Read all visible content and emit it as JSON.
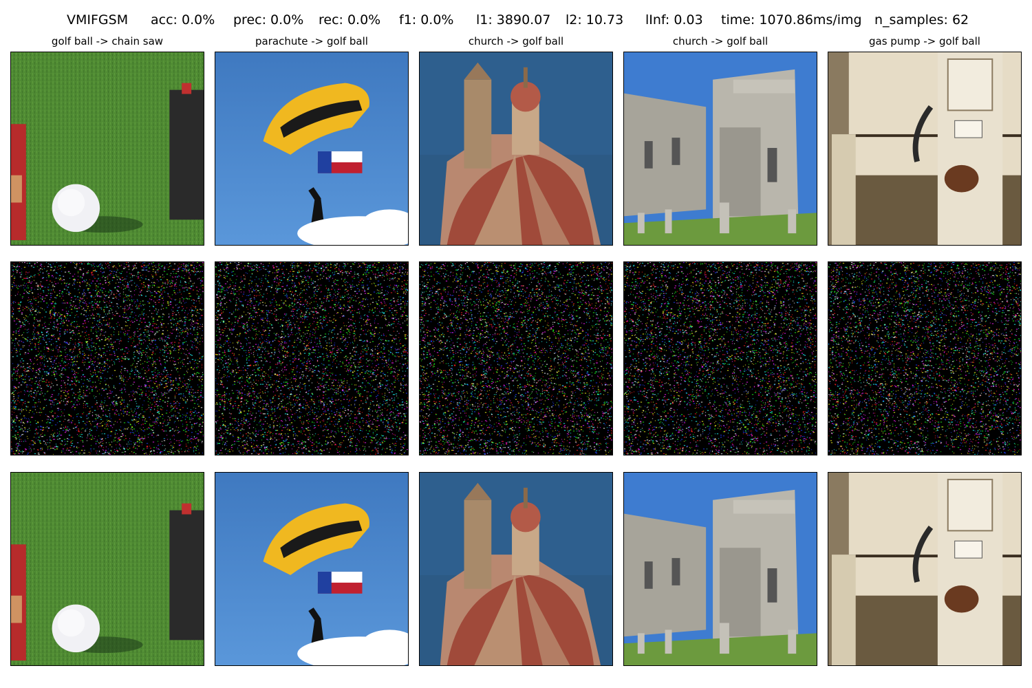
{
  "suptitle": {
    "method": "VMIFGSM",
    "acc": "acc: 0.0%",
    "prec": "prec: 0.0%",
    "rec": "rec: 0.0%",
    "f1": "f1: 0.0%",
    "l1": "l1: 3890.07",
    "l2": "l2: 10.73",
    "linf": "lInf: 0.03",
    "time": "time: 1070.86ms/img",
    "n_samples": "n_samples: 62"
  },
  "columns": [
    {
      "title": "golf ball -> chain saw",
      "image": "golf ball on grass with red sign and car battery"
    },
    {
      "title": "parachute -> golf ball",
      "image": "parachutist with yellow Army canopy and Texas flag"
    },
    {
      "title": "church -> golf ball",
      "image": "church dome with bell tower over the sea"
    },
    {
      "title": "church -> golf ball",
      "image": "stone church with graveyard"
    },
    {
      "title": "gas pump -> golf ball",
      "image": "old rusty gas pump by a fence"
    }
  ],
  "rows": [
    "original",
    "perturbation",
    "adversarial"
  ],
  "noise_colors": [
    "#ff2020",
    "#20ff20",
    "#2040ff",
    "#ff20ff",
    "#20ffff",
    "#ffff20",
    "#ffffff"
  ]
}
